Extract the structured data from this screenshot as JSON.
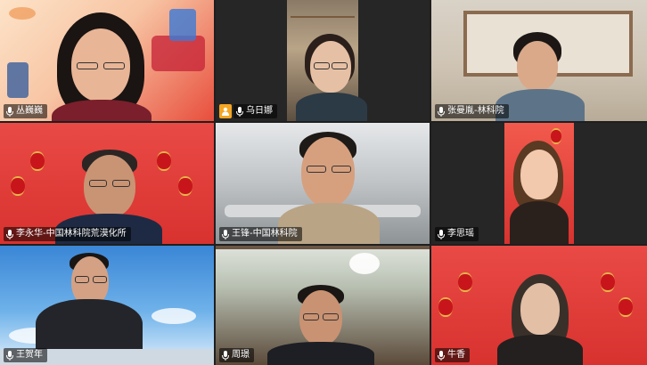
{
  "meeting": {
    "participants": [
      {
        "name": "丛巍巍"
      },
      {
        "name": "乌日娜"
      },
      {
        "name": "张曼胤-林科院"
      },
      {
        "name": "李永华-中国林科院荒漠化所"
      },
      {
        "name": "王锋-中国林科院"
      },
      {
        "name": "李思瑶"
      },
      {
        "name": "王贺年"
      },
      {
        "name": "周璟"
      },
      {
        "name": "牛香"
      }
    ]
  },
  "colors": {
    "active_speaker_border": "#3fbf5f",
    "host_badge": "#f5a623",
    "label_bg": "rgba(0,0,0,0.55)"
  },
  "icons": {
    "mic": "microphone-icon",
    "host": "host-person-icon"
  }
}
